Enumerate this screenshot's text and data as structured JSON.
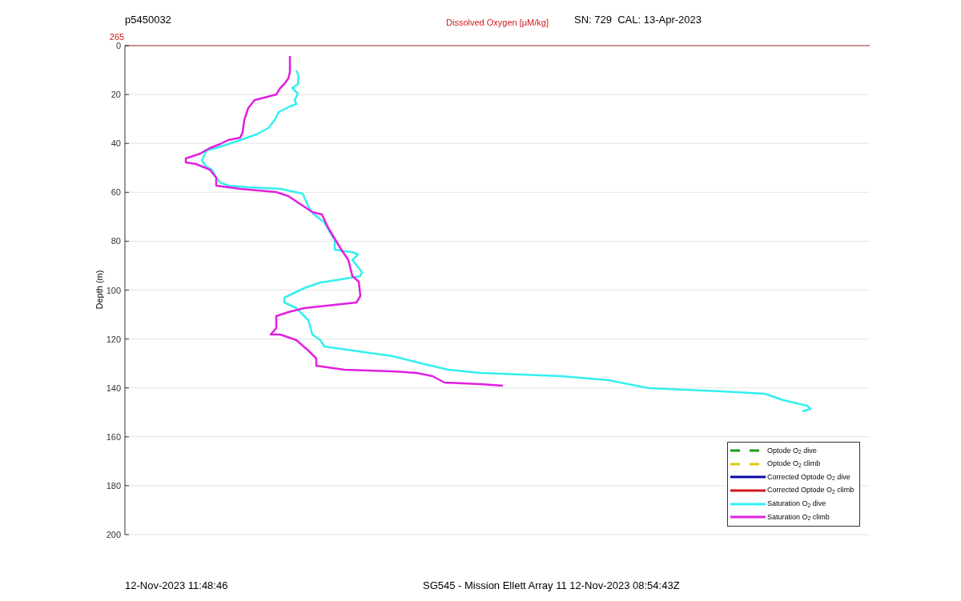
{
  "header": {
    "profile": "p5450032",
    "variable": "Dissolved Oxygen [μM/kg]",
    "calibration": "SN: 729  CAL: 13-Apr-2023"
  },
  "plot": {
    "x_top_label": "265",
    "ylabel": "Depth (m)",
    "yticks": [
      "0",
      "20",
      "40",
      "60",
      "80",
      "100",
      "120",
      "140",
      "160",
      "180",
      "200"
    ]
  },
  "legend": [
    {
      "label": "Optode O$_{2}$ dive",
      "color": "#1a9a1a",
      "kind": "dashed"
    },
    {
      "label": "Optode O$_{2}$ climb",
      "color": "#d8cc10",
      "kind": "dashed"
    },
    {
      "label": "Corrected Optode O$_{2}$ dive",
      "color": "#0a0aa8",
      "kind": "solid"
    },
    {
      "label": "Corrected Optode O$_{2}$ climb",
      "color": "#d01818",
      "kind": "solid"
    },
    {
      "label": "Saturation O$_{2}$ dive",
      "color": "#33f0f0",
      "kind": "solid"
    },
    {
      "label": "Saturation O$_{2}$ climb",
      "color": "#e020e0",
      "kind": "solid"
    }
  ],
  "footer": {
    "timestamp": "12-Nov-2023 11:48:46",
    "mission": "SG545 - Mission Ellett Array 11 12-Nov-2023 08:54:43Z"
  }
}
